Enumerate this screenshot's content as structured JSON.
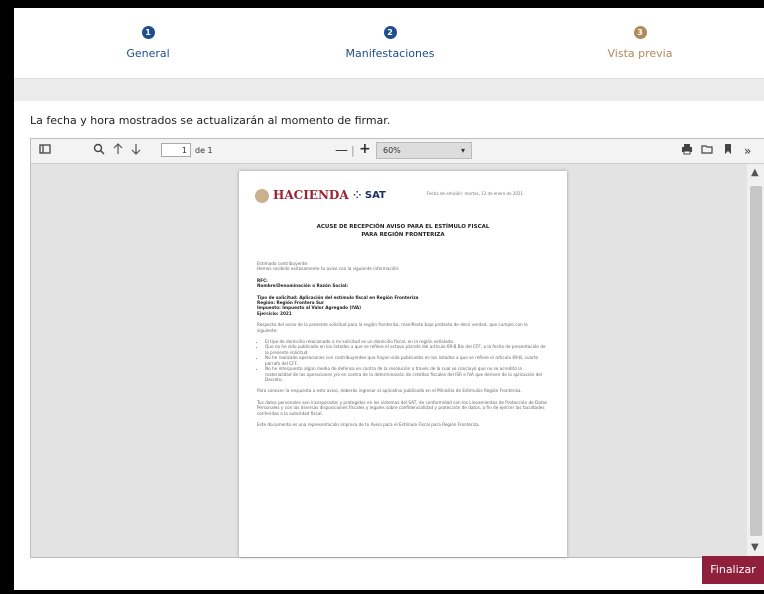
{
  "steps": [
    {
      "num": "1",
      "label": "General",
      "color": "#1f4e8c"
    },
    {
      "num": "2",
      "label": "Manifestaciones",
      "color": "#1f4e8c"
    },
    {
      "num": "3",
      "label": "Vista previa",
      "color": "#b08a5a"
    }
  ],
  "notice": "La fecha y hora mostrados se actualizarán al momento de firmar.",
  "viewer": {
    "page_value": "1",
    "page_total": "de 1",
    "zoom_minus": "—",
    "zoom_plus": "+",
    "zoom_value": "60%"
  },
  "doc": {
    "logo_hacienda": "HACIENDA",
    "logo_sat": "SAT",
    "date_line": "Fecha de emisión: martes, 12 de enero de 2021",
    "title_1": "ACUSE DE RECEPCIÓN AVISO PARA EL ESTÍMULO FISCAL",
    "title_2": "PARA REGIÓN FRONTERIZA",
    "greeting": "Estimado contribuyente:",
    "intro": "Hemos recibido exitosamente tu aviso con la siguiente información:",
    "rfc": "RFC:",
    "nombre": "Nombre/Denominación o Razón Social:",
    "tipo": "Tipo de solicitud: Aplicación del estímulo fiscal en Región Fronteriza",
    "region": "Región: Región Frontera Sur",
    "impuesto": "Impuesto: Impuesto al Valor Agregado (IVA)",
    "ejercicio": "Ejercicio: 2021",
    "respecto": "Respecto del aviso de la presente solicitud para la región fronteriza, manifiesto bajo protesta de decir verdad, que cumplo con lo siguiente:",
    "bullets": [
      "El tipo de domicilio relacionado a mi solicitud es un domicilio fiscal, en la región señalada.",
      "Que no he sido publicado en los listados a que se refiere el octavo párrafo del artículo 69-B Bis del CFF, a la fecha de presentación de la presente solicitud.",
      "No he realizado operaciones con contribuyentes que hayan sido publicados en los listados a que se refiere el artículo 69-B, cuarto párrafo del CFF.",
      "No he interpuesto algún medio de defensa en contra de la resolución a través de la cual se concluyó que no se acreditó la materialidad de las operaciones y/o en contra de la determinación de créditos fiscales del ISR e IVA que deriven de la aplicación del Decreto."
    ],
    "conocer": "Para conocer la respuesta a este aviso, deberás ingresar al aplicativo publicado en el Minisitio de Estímulos Región Fronteriza.",
    "datos": "Tus datos personales son incorporados y protegidos en los sistemas del SAT, de conformidad con los Lineamientos de Protección de Datos Personales y con las diversas disposiciones fiscales y legales sobre confidencialidad y protección de datos, a fin de ejercer las facultades conferidas a la autoridad fiscal.",
    "representacion": "Este documento es una representación impresa de tu Aviso para el Estímulo Fiscal para Región Fronteriza."
  },
  "finalize_label": "Finalizar"
}
